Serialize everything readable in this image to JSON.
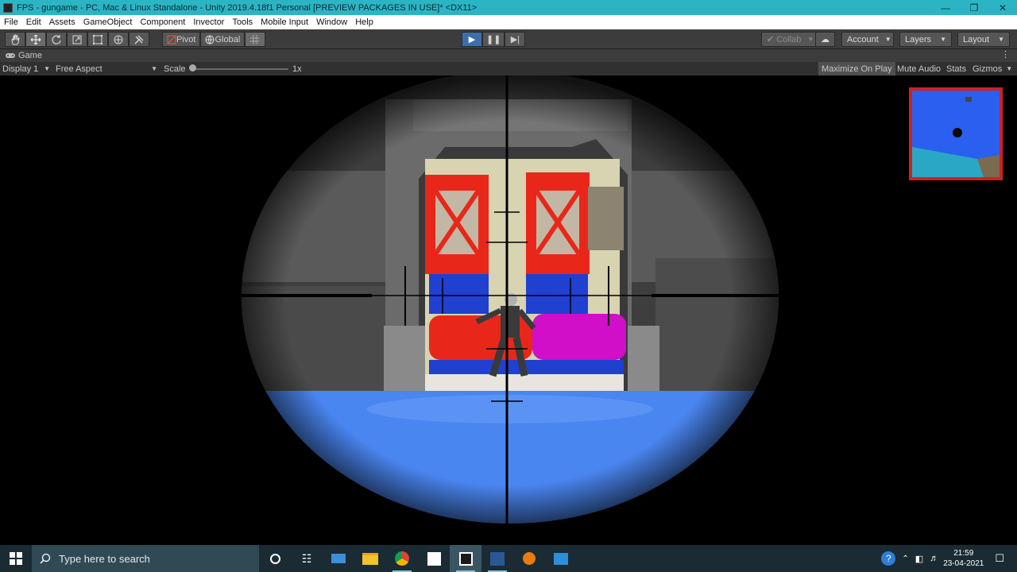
{
  "window": {
    "title": "FPS - gungame - PC, Mac & Linux Standalone - Unity 2019.4.18f1 Personal [PREVIEW PACKAGES IN USE]* <DX11>",
    "min_icon": "minimize-icon",
    "max_icon": "maximize-icon",
    "close_icon": "close-icon"
  },
  "menu": [
    "File",
    "Edit",
    "Assets",
    "GameObject",
    "Component",
    "Invector",
    "Tools",
    "Mobile Input",
    "Window",
    "Help"
  ],
  "toolbar": {
    "pivot_label": "Pivot",
    "global_label": "Global",
    "collab_label": "Collab",
    "account_label": "Account",
    "layers_label": "Layers",
    "layout_label": "Layout"
  },
  "game_tab": {
    "label": "Game",
    "display": "Display 1",
    "aspect": "Free Aspect",
    "scale_label": "Scale",
    "scale_value": "1x",
    "scale_level": 0.0,
    "maximize_on_play": "Maximize On Play",
    "mute_audio": "Mute Audio",
    "stats": "Stats",
    "gizmos": "Gizmos"
  },
  "taskbar": {
    "search_placeholder": "Type here to search",
    "time": "21:59",
    "date": "23-04-2021"
  },
  "colors": {
    "titlebar": "#2bb5c4",
    "floor": "#4a86f0",
    "minimap_border": "#d02020",
    "cylinder_red": "#e8271a",
    "cylinder_magenta": "#d10fc8"
  }
}
